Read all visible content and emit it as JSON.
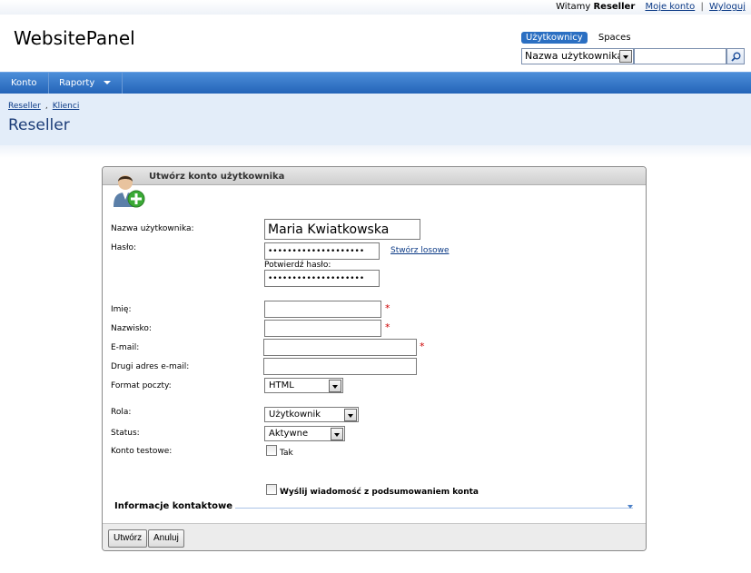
{
  "topbar": {
    "greeting": "Witamy",
    "user": "Reseller",
    "my_account": "Moje konto",
    "separator": "|",
    "logout": "Wyloguj"
  },
  "brand": "WebsitePanel",
  "search": {
    "tabs": [
      "Użytkownicy",
      "Spaces"
    ],
    "field_selected": "Nazwa użytkownika",
    "query": ""
  },
  "nav": {
    "items": [
      {
        "label": "Konto"
      },
      {
        "label": "Raporty"
      }
    ]
  },
  "breadcrumb": {
    "items": [
      "Reseller",
      "Klienci"
    ],
    "separator": ","
  },
  "page_title": "Reseller",
  "form": {
    "title": "Utwórz konto użytkownika",
    "username_label": "Nazwa użytkownika:",
    "username_value": "Maria Kwiatkowska",
    "password_label": "Hasło:",
    "password_value": "••••••••••••••••••••",
    "generate_link": "Stwórz losowe",
    "confirm_label": "Potwierdź hasło:",
    "confirm_value": "••••••••••••••••••••",
    "first_name_label": "Imię:",
    "last_name_label": "Nazwisko:",
    "email_label": "E-mail:",
    "second_email_label": "Drugi adres e-mail:",
    "mail_format_label": "Format poczty:",
    "mail_format_value": "HTML",
    "role_label": "Rola:",
    "role_value": "Użytkownik",
    "status_label": "Status:",
    "status_value": "Aktywne",
    "demo_label": "Konto testowe:",
    "demo_option": "Tak",
    "send_summary_label": "Wyślij wiadomość z podsumowaniem konta",
    "required_mark": "*",
    "contact_section": "Informacje kontaktowe"
  },
  "buttons": {
    "create": "Utwórz",
    "cancel": "Anuluj"
  },
  "colors": {
    "nav_bar": "#2f74c8",
    "header_band": "#e3edf9",
    "title": "#1c3d78",
    "required": "#cc0000",
    "active_tab": "#2b6fc2"
  }
}
